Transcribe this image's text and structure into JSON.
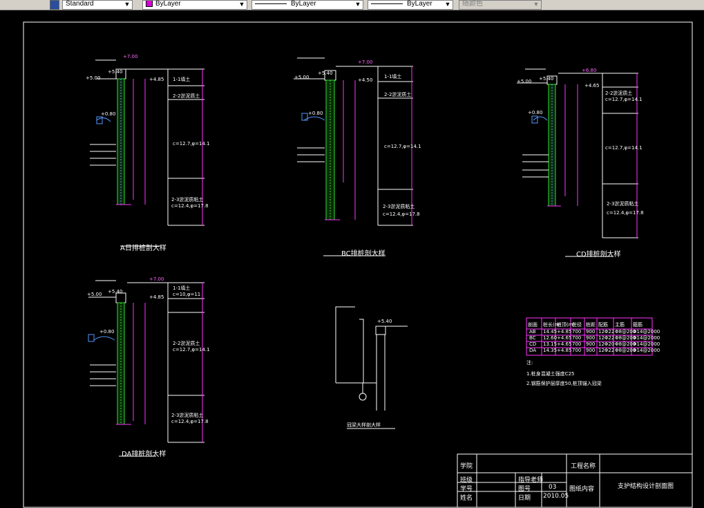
{
  "toolbar": {
    "style_value": "Standard",
    "color_value": "ByLayer",
    "linetype_value": "ByLayer",
    "lineweight_value": "ByLayer",
    "plotstyle_value": "随颜色",
    "accent_color": "#d600d6"
  },
  "sections": {
    "a_title": "A日排桩剖大样",
    "bc_title": "BC排桩剖大样",
    "cd_title": "CD排桩剖大样",
    "da_title": "DA排桩剖大样",
    "detail_title": "冠梁大样剖大样"
  },
  "elevations": {
    "top": "+7.00",
    "cap": "+5.40",
    "left": "+5.00",
    "mid": "+0.80",
    "right": "+4.85",
    "right_bc": "+4.50",
    "right_cd": "+4.65",
    "top_cd": "+6.80"
  },
  "soil_layers": {
    "layer1_name": "1-1填土",
    "layer1_param": "c=10,φ=11",
    "layer2_name": "2-2淤泥质土",
    "layer2_param": "c=12.7,φ=14.1",
    "layer3_name": "2-3淤泥质粘土",
    "layer3_param": "c=12.4,φ=17.8"
  },
  "table": {
    "header": [
      "剖面",
      "桩长(m)",
      "桩顶(m)",
      "桩径",
      "桩距",
      "配筋",
      "主筋",
      "箍筋"
    ],
    "rows": [
      [
        "AB",
        "14.45",
        "+4.85",
        "700",
        "900",
        "12Φ22",
        "Φ8@200",
        "Φ14@2000"
      ],
      [
        "BC",
        "12.60",
        "+4.65",
        "700",
        "900",
        "12Φ22",
        "Φ8@200",
        "Φ14@2000"
      ],
      [
        "CD",
        "13.15",
        "+4.65",
        "700",
        "900",
        "12Φ20",
        "Φ8@200",
        "Φ14@2000"
      ],
      [
        "DA",
        "14.35",
        "+4.85",
        "700",
        "900",
        "12Φ22",
        "Φ8@200",
        "Φ14@2000"
      ]
    ],
    "notes": [
      "注:",
      "1.桩身混凝土强度C25",
      "2.钢筋保护层厚度50,桩顶锚入冠梁"
    ]
  },
  "title_block": {
    "school_label": "学院",
    "project_label": "工程名称",
    "class_label": "班级",
    "advisor_label": "指导老师",
    "student_no_label": "学号",
    "drawing_no_label": "图号",
    "drawing_no_value": "03",
    "content_label": "图纸内容",
    "content_value": "支护结构设计剖面图",
    "name_label": "姓名",
    "date_label": "日期",
    "date_value": "2010.05"
  }
}
